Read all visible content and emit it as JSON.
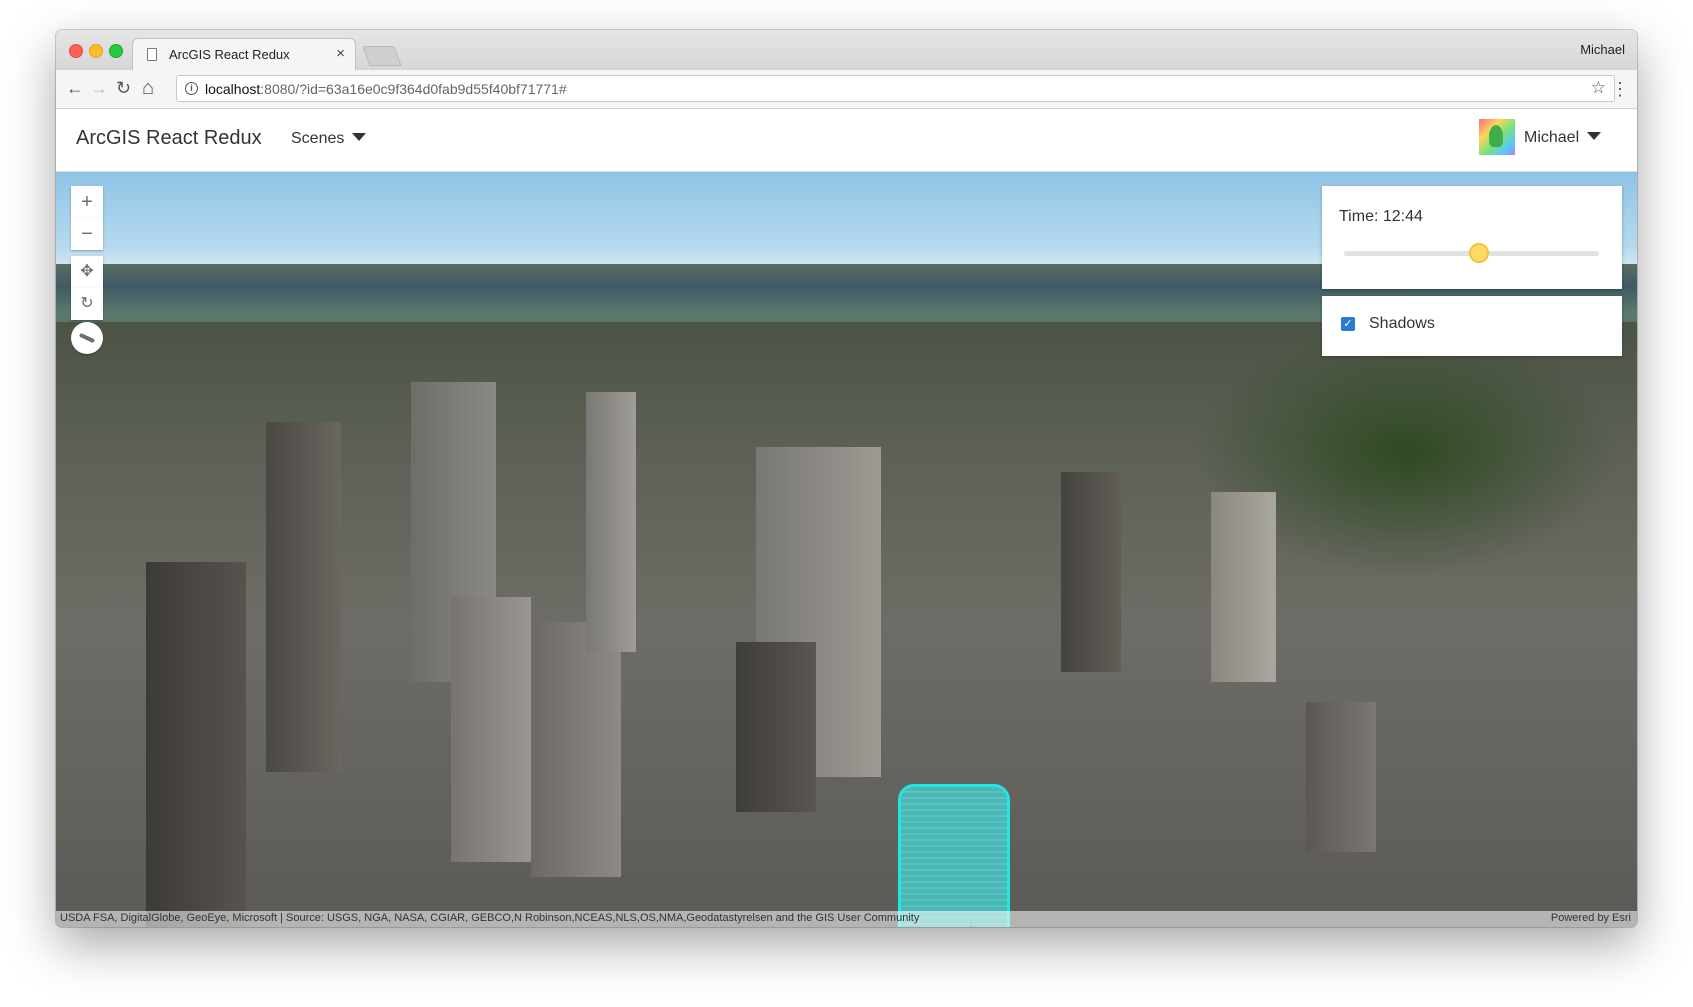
{
  "browser": {
    "tab_title": "ArcGIS React Redux",
    "tab_close": "×",
    "profile_name": "Michael",
    "url_host": "localhost",
    "url_rest": ":8080/?id=63a16e0c9f364d0fab9d55f40bf71771#",
    "back_icon": "←",
    "forward_icon": "→",
    "reload_icon": "↻",
    "home_icon": "⌂",
    "info_icon": "i",
    "star_icon": "☆",
    "menu_icon": "⋮"
  },
  "app": {
    "brand": "ArcGIS React Redux",
    "scenes_menu": "Scenes",
    "user_name": "Michael"
  },
  "map": {
    "zoom_in": "+",
    "zoom_out": "−",
    "pan_icon": "✥",
    "rotate_icon": "↻",
    "time_label": "Time: 12:44",
    "time_slider_fraction": 0.53,
    "shadows_label": "Shadows",
    "shadows_checked": true,
    "checkmark": "✓",
    "attribution": "USDA FSA, DigitalGlobe, GeoEye, Microsoft | Source: USGS, NGA, NASA, CGIAR, GEBCO,N Robinson,NCEAS,NLS,OS,NMA,Geodatastyrelsen and the GIS User Community",
    "powered_by": "Powered by Esri"
  },
  "colors": {
    "highlight": "#22e6e2",
    "slider_thumb": "#ffd966",
    "checkbox": "#2b7bd6"
  }
}
